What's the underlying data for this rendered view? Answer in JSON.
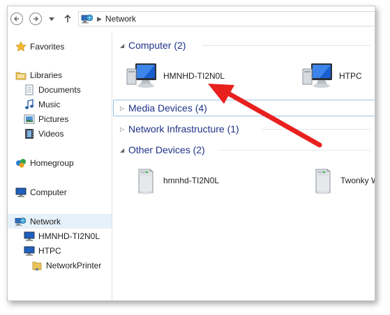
{
  "toolbar": {
    "back_icon": "back-arrow-icon",
    "forward_icon": "forward-arrow-icon",
    "recent_icon": "dropdown-icon",
    "up_icon": "up-arrow-icon",
    "address": {
      "location_icon": "network-icon",
      "separator": "▶",
      "crumb": "Network"
    }
  },
  "sidebar": {
    "favorites": "Favorites",
    "libraries": "Libraries",
    "documents": "Documents",
    "music": "Music",
    "pictures": "Pictures",
    "videos": "Videos",
    "homegroup": "Homegroup",
    "computer": "Computer",
    "network": "Network",
    "hmnhd": "HMNHD-TI2N0L",
    "htpc": "HTPC",
    "networkprinter": "NetworkPrinter"
  },
  "groups": {
    "computer": {
      "title": "Computer (2)",
      "expanded": true
    },
    "media": {
      "title": "Media Devices (4)",
      "expanded": false
    },
    "infrastructure": {
      "title": "Network Infrastructure (1)",
      "expanded": false
    },
    "other": {
      "title": "Other Devices (2)",
      "expanded": true
    }
  },
  "items": {
    "computer1": "HMNHD-TI2N0L",
    "computer2": "HTPC",
    "other1": "hmnhd-TI2N0L",
    "other2": "Twonky W"
  },
  "colors": {
    "group_title": "#1e3287",
    "selection": "#e5f1fb",
    "focus_border": "#99c4e6",
    "annotation_arrow": "#e8201e"
  }
}
